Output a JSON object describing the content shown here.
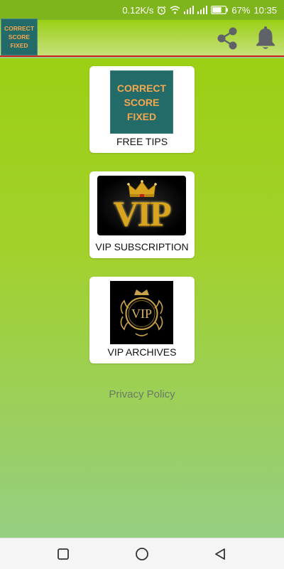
{
  "status_bar": {
    "network_speed": "0.12K/s",
    "battery_percent": "67%",
    "time": "10:35",
    "icons": [
      "alarm-icon",
      "wifi-icon",
      "signal-icon",
      "signal-icon",
      "battery-icon"
    ]
  },
  "app_bar": {
    "logo_lines": [
      "CORRECT",
      "SCORE",
      "FIXED"
    ],
    "actions": [
      "share-icon",
      "bell-icon"
    ]
  },
  "cards": {
    "free_tips": {
      "image_lines": [
        "CORRECT",
        "SCORE",
        "FIXED"
      ],
      "label": "FREE TIPS"
    },
    "vip_subscription": {
      "image_text": "VIP",
      "label": "VIP SUBSCRIPTION"
    },
    "vip_archives": {
      "image_text": "VIP",
      "label": "VIP ARCHIVES"
    }
  },
  "privacy_policy": "Privacy Policy",
  "nav_bar": {
    "buttons": [
      "recents-square-icon",
      "home-circle-icon",
      "back-triangle-icon"
    ]
  },
  "colors": {
    "app_bar_green": "#9ad016",
    "logo_teal": "#236b69",
    "logo_orange": "#f6a74e",
    "vip_gold": "#d9a520",
    "divider_red": "#cc2020"
  }
}
